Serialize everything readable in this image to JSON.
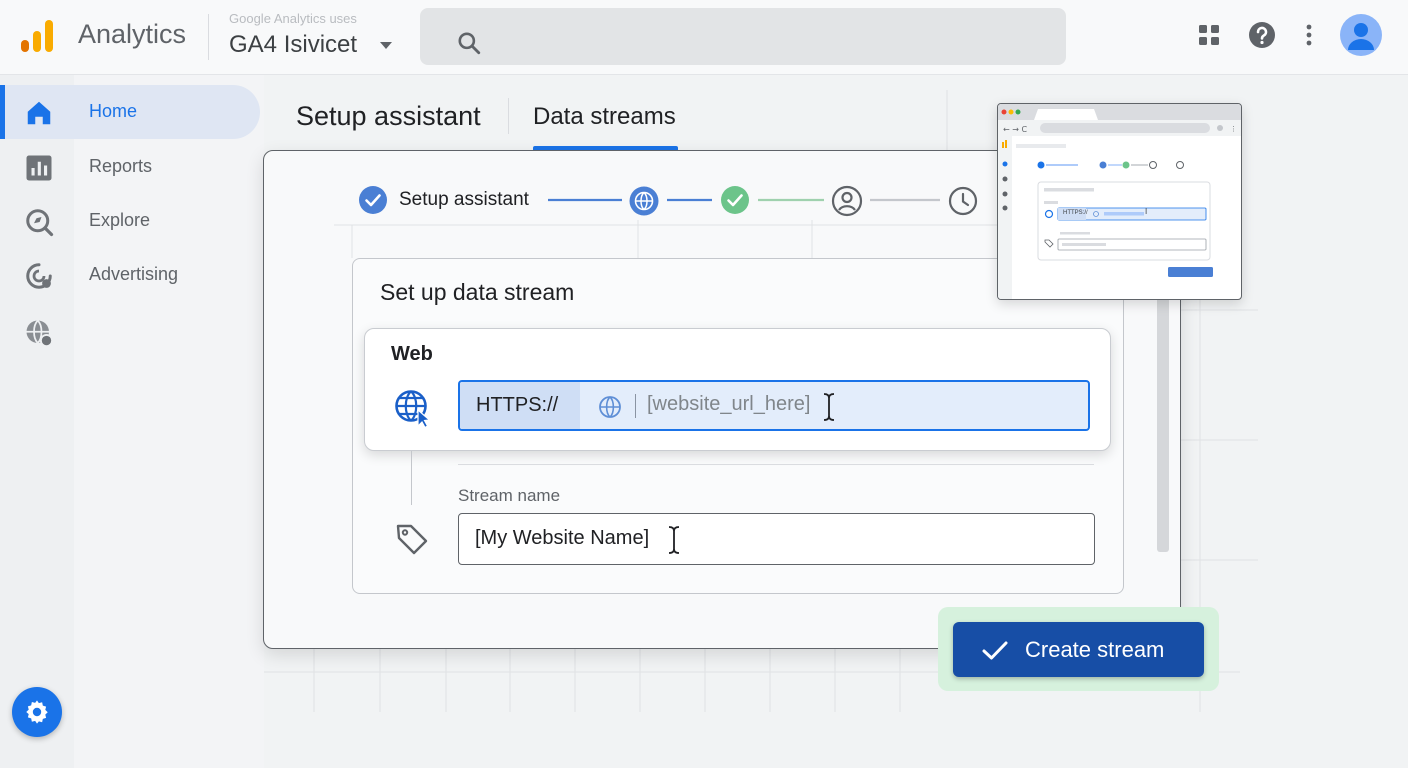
{
  "app": {
    "name": "Analytics",
    "account_sub": "Google Analytics uses",
    "property": "GA4 Isivicet"
  },
  "search": {
    "placeholder": ""
  },
  "nav": {
    "items": [
      {
        "label": "Home",
        "icon": "home-icon",
        "active": true
      },
      {
        "label": "Reports",
        "icon": "reports-icon",
        "active": false
      },
      {
        "label": "Explore",
        "icon": "explore-icon",
        "active": false
      },
      {
        "label": "Advertising",
        "icon": "advertising-icon",
        "active": false
      }
    ],
    "extra_icon": "globe-settings-icon",
    "settings_icon": "gear-icon"
  },
  "tabs": {
    "title": "Setup assistant",
    "active_tab": "Data streams"
  },
  "stepper": {
    "first_step_label": "Setup assistant",
    "steps": [
      "check-icon",
      "globe-icon",
      "check-icon",
      "person-icon",
      "clock-icon"
    ]
  },
  "form": {
    "title": "Set up data stream",
    "platform_label": "Web",
    "url_prefix": "HTTPS://",
    "url_placeholder": "[website_url_here]",
    "stream_name_label": "Stream name",
    "stream_name_value": "[My Website Name]",
    "submit_label": "Create stream"
  },
  "thumbnail": {
    "url_prefix": "HTTPS://"
  },
  "colors": {
    "accent": "#1a73e8",
    "button": "#174ea6",
    "success": "#34a853",
    "logo_orange": "#f9ab00",
    "logo_dark": "#e37400"
  }
}
